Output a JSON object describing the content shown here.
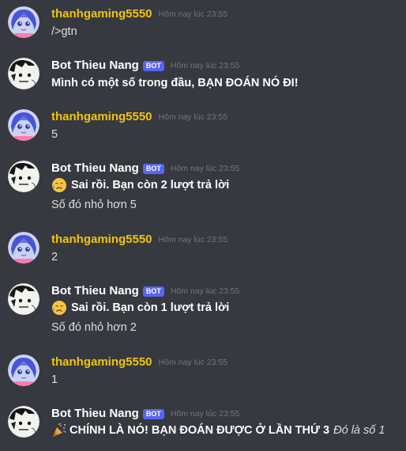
{
  "messages": [
    {
      "author": "thanhgaming5550",
      "timestamp": "Hôm nay lúc 23:55",
      "lines": [
        "/>gtn"
      ]
    },
    {
      "author": "Bot Thieu Nang",
      "bot_tag": "BOT",
      "timestamp": "Hôm nay lúc 23:55",
      "lines": [
        "Mình có một số trong đầu, BẠN ĐOÁN NÓ ĐI!"
      ]
    },
    {
      "author": "thanhgaming5550",
      "timestamp": "Hôm nay lúc 23:55",
      "lines": [
        "5"
      ]
    },
    {
      "author": "Bot Thieu Nang",
      "bot_tag": "BOT",
      "timestamp": "Hôm nay lúc 23:55",
      "lines": [
        "Sai rồi. Bạn còn 2 lượt trả lời",
        "Số đó nhỏ hơn 5"
      ],
      "emoji": "sad-sweat-emoji"
    },
    {
      "author": "thanhgaming5550",
      "timestamp": "Hôm nay lúc 23:55",
      "lines": [
        "2"
      ]
    },
    {
      "author": "Bot Thieu Nang",
      "bot_tag": "BOT",
      "timestamp": "Hôm nay lúc 23:55",
      "lines": [
        "Sai rồi. Bạn còn 1 lượt trả lời",
        "Số đó nhỏ hơn 2"
      ],
      "emoji": "sad-sweat-emoji"
    },
    {
      "author": "thanhgaming5550",
      "timestamp": "Hôm nay lúc 23:55",
      "lines": [
        "1"
      ]
    },
    {
      "author": "Bot Thieu Nang",
      "bot_tag": "BOT",
      "timestamp": "Hôm nay lúc 23:55",
      "lines": [
        "CHÍNH LÀ NÓ! BẠN ĐOÁN ĐƯỢC Ở LẦN THỨ 3"
      ],
      "extra": "Đó là số 1",
      "emoji": "party-popper-emoji"
    }
  ],
  "colors": {
    "background": "#36393f",
    "user_name": "#f1c40f",
    "bot_tag": "#5865f2",
    "timestamp": "#72767d"
  }
}
